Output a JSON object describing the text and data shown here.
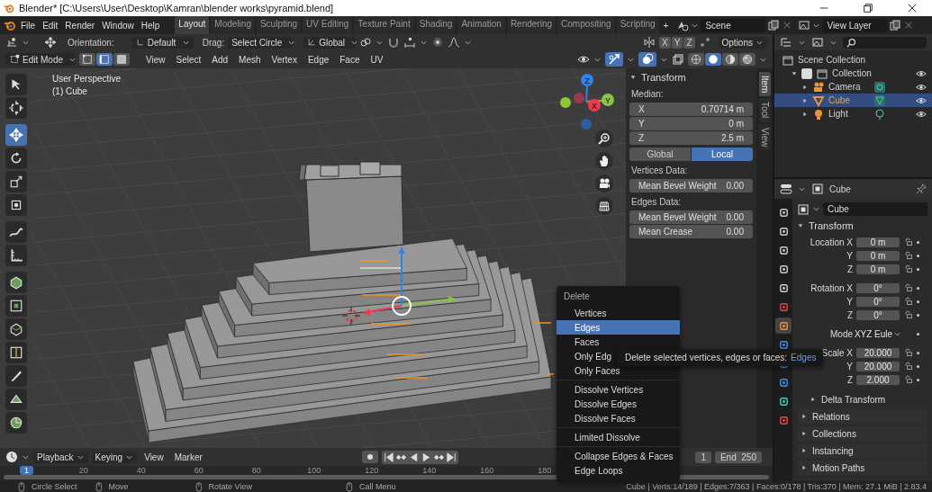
{
  "title_bar": {
    "title": "Blender* [C:\\Users\\User\\Desktop\\Kamran\\blender works\\pyramid.blend]"
  },
  "menu_bar": [
    "File",
    "Edit",
    "Render",
    "Window",
    "Help"
  ],
  "workspace_tabs": [
    {
      "label": "Layout",
      "selected": true
    },
    {
      "label": "Modeling",
      "selected": false
    },
    {
      "label": "Sculpting",
      "selected": false
    },
    {
      "label": "UV Editing",
      "selected": false
    },
    {
      "label": "Texture Paint",
      "selected": false
    },
    {
      "label": "Shading",
      "selected": false
    },
    {
      "label": "Animation",
      "selected": false
    },
    {
      "label": "Rendering",
      "selected": false
    },
    {
      "label": "Compositing",
      "selected": false
    },
    {
      "label": "Scripting",
      "selected": false
    }
  ],
  "add_workspace": "+",
  "scene": "Scene",
  "view_layer": "View Layer",
  "tool_settings": {
    "orientation_label": "Orientation:",
    "orientation": "Default",
    "drag_label": "Drag:",
    "drag": "Select Circle",
    "transform": "Global",
    "mirror_axes": [
      "X",
      "Y",
      "Z"
    ],
    "options": "Options"
  },
  "viewport_header": {
    "mode": "Edit Mode",
    "select_modes": [
      {
        "selected": false
      },
      {
        "selected": true
      },
      {
        "selected": false
      }
    ],
    "menus": [
      "View",
      "Select",
      "Add",
      "Mesh",
      "Vertex",
      "Edge",
      "Face",
      "UV"
    ],
    "shading_modes": [
      {
        "selected": false
      },
      {
        "selected": true
      },
      {
        "selected": false
      },
      {
        "selected": false
      }
    ]
  },
  "toolbar": [
    [
      {
        "selected": false
      },
      {
        "selected": false
      }
    ],
    [
      {
        "selected": true
      },
      {
        "selected": false
      },
      {
        "selected": false
      },
      {
        "selected": false
      }
    ],
    [
      {
        "selected": false
      },
      {
        "selected": false
      }
    ],
    [
      {
        "selected": false
      },
      {
        "selected": false
      },
      {
        "selected": false
      },
      {
        "selected": false
      },
      {
        "selected": false
      },
      {
        "selected": false
      },
      {
        "selected": false
      }
    ]
  ],
  "viewport": {
    "view_name": "User Perspective",
    "object_name": "(1) Cube",
    "gizmo_axes": [
      "Z",
      "Y",
      "X"
    ]
  },
  "sidebar": {
    "tabs": [
      {
        "label": "Item",
        "selected": true
      },
      {
        "label": "Tool",
        "selected": false
      },
      {
        "label": "View",
        "selected": false
      }
    ],
    "panel_title": "Transform",
    "median_label": "Median:",
    "median": [
      {
        "label": "X",
        "value": "0.70714 m"
      },
      {
        "label": "Y",
        "value": "0 m"
      },
      {
        "label": "Z",
        "value": "2.5 m"
      }
    ],
    "space": [
      {
        "label": "Global",
        "selected": false
      },
      {
        "label": "Local",
        "selected": true
      }
    ],
    "sections": [
      {
        "title": "Vertices Data:",
        "fields": [
          {
            "label": "Mean Bevel Weight",
            "value": "0.00"
          }
        ]
      },
      {
        "title": "Edges Data:",
        "fields": [
          {
            "label": "Mean Bevel Weight",
            "value": "0.00"
          },
          {
            "label": "Mean Crease",
            "value": "0.00"
          }
        ]
      }
    ]
  },
  "outliner": {
    "root": "Scene Collection",
    "items": [
      {
        "label": "Collection",
        "kind": "collection",
        "checked": true,
        "selected": false,
        "children": [
          {
            "label": "Camera",
            "kind": "camera",
            "selected": false
          },
          {
            "label": "Cube",
            "kind": "mesh",
            "selected": true
          },
          {
            "label": "Light",
            "kind": "light",
            "selected": false
          }
        ]
      }
    ]
  },
  "properties": {
    "object": "Cube",
    "name_field": "Cube",
    "tabs": [
      {
        "selected": false
      },
      {
        "selected": false
      },
      {
        "selected": false
      },
      {
        "selected": false
      },
      {
        "selected": false
      },
      {
        "selected": false
      },
      {
        "selected": true
      },
      {
        "selected": false
      },
      {
        "selected": false
      },
      {
        "selected": false
      },
      {
        "selected": false
      },
      {
        "selected": false
      }
    ],
    "panel_title": "Transform",
    "groups": [
      [
        {
          "label": "Location X",
          "value": "0 m",
          "kind": "number"
        },
        {
          "label": "Y",
          "value": "0 m",
          "kind": "number"
        },
        {
          "label": "Z",
          "value": "0 m",
          "kind": "number"
        }
      ],
      [
        {
          "label": "Rotation X",
          "value": "0°",
          "kind": "number"
        },
        {
          "label": "Y",
          "value": "0°",
          "kind": "number"
        },
        {
          "label": "Z",
          "value": "0°",
          "kind": "number"
        }
      ],
      [
        {
          "label": "Mode",
          "value": "XYZ Eule",
          "kind": "dropdown"
        }
      ],
      [
        {
          "label": "Scale X",
          "value": "20.000",
          "kind": "number"
        },
        {
          "label": "Y",
          "value": "20.000",
          "kind": "number"
        },
        {
          "label": "Z",
          "value": "2.000",
          "kind": "number"
        }
      ]
    ],
    "panels": [
      {
        "label": "Delta Transform",
        "kind": "subpanel"
      },
      {
        "label": "Relations",
        "kind": "panel"
      },
      {
        "label": "Collections",
        "kind": "panel"
      },
      {
        "label": "Instancing",
        "kind": "panel"
      },
      {
        "label": "Motion Paths",
        "kind": "panel"
      }
    ]
  },
  "timeline": {
    "menus": [
      {
        "label": "Playback",
        "dropdown": true
      },
      {
        "label": "Keying",
        "dropdown": true
      },
      {
        "label": "View",
        "dropdown": false
      },
      {
        "label": "Marker",
        "dropdown": false
      }
    ],
    "start": "1",
    "end_label": "End",
    "end": "250",
    "current_frame": "1",
    "ticks": [
      "20",
      "40",
      "60",
      "80",
      "100",
      "120",
      "140",
      "160",
      "180"
    ]
  },
  "delete_menu": {
    "title": "Delete",
    "groups": [
      [
        {
          "label": "Vertices",
          "selected": false
        },
        {
          "label": "Edges",
          "selected": true
        },
        {
          "label": "Faces",
          "selected": false
        },
        {
          "label": "Only Edg",
          "selected": false
        },
        {
          "label": "Only Faces",
          "selected": false
        }
      ],
      [
        {
          "label": "Dissolve Vertices",
          "selected": false
        },
        {
          "label": "Dissolve Edges",
          "selected": false
        },
        {
          "label": "Dissolve Faces",
          "selected": false
        }
      ],
      [
        {
          "label": "Limited Dissolve",
          "selected": false
        }
      ],
      [
        {
          "label": "Collapse Edges & Faces",
          "selected": false
        },
        {
          "label": "Edge Loops",
          "selected": false
        }
      ]
    ]
  },
  "tooltip": {
    "text": "Delete selected vertices, edges or faces:",
    "value": "Edges"
  },
  "status_bar": {
    "hints": [
      "Circle Select",
      "Move",
      "Rotate View",
      "Call Menu"
    ],
    "stats": "Cube | Verts:14/189 | Edges:7/363 | Faces:0/178 | Tris:370 | Mem: 27.1 MiB | 2.83.4"
  }
}
